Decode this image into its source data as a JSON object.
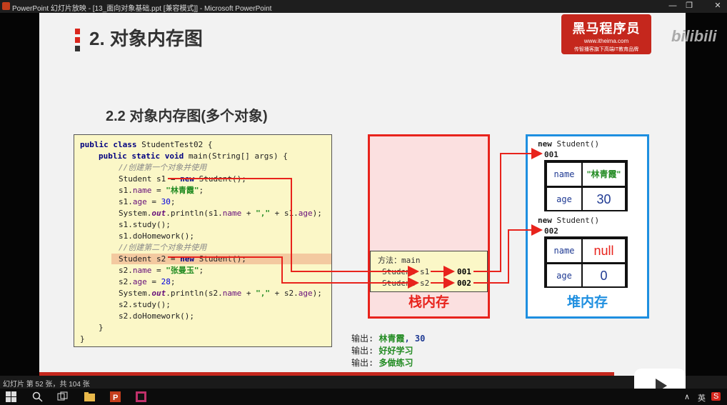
{
  "window": {
    "title": "PowerPoint 幻灯片放映 - [13_面向对象基础.ppt [兼容模式]] - Microsoft PowerPoint",
    "controls": [
      "—",
      "❐",
      "✕"
    ]
  },
  "slide": {
    "title": "2. 对象内存图",
    "subtitle": "2.2 对象内存图(多个对象)",
    "logo": {
      "name": "黑马程序员",
      "url": "www.itheima.com",
      "tagline": "传智播客旗下高端IT教育品牌"
    },
    "code": {
      "l1a": "public class",
      "l1b": " StudentTest02 {",
      "l2a": "public static void",
      "l2b": " main(String[] args) {",
      "c1": "//创建第一个对象并使用",
      "l4a": "Student s1 = ",
      "l4b": "new",
      "l4c": " Student();",
      "l5a": "s1.",
      "l5b": "name",
      "l5c": " = ",
      "l5d": "\"林青霞\"",
      "l5e": ";",
      "l6a": "s1.",
      "l6b": "age",
      "l6c": " = ",
      "l6d": "30",
      "l6e": ";",
      "l7a": "System.",
      "l7b": "out",
      "l7c": ".println(s1.",
      "l7d": "name",
      "l7e": " + ",
      "l7f": "\",\"",
      "l7g": " + s1.",
      "l7h": "age",
      "l7i": ");",
      "l8": "s1.study();",
      "l9": "s1.doHomework();",
      "c2": "//创建第二个对象并使用",
      "l11a": "Student s2 = ",
      "l11b": "new",
      "l11c": " Student();",
      "l12a": "s2.",
      "l12b": "name",
      "l12c": " = ",
      "l12d": "\"张曼玉\"",
      "l12e": ";",
      "l13a": "s2.",
      "l13b": "age",
      "l13c": " = ",
      "l13d": "28",
      "l13e": ";",
      "l14a": "System.",
      "l14b": "out",
      "l14c": ".println(s2.",
      "l14d": "name",
      "l14e": " + ",
      "l14f": "\",\"",
      "l14g": " + s2.",
      "l14h": "age",
      "l14i": ");",
      "l15": "s2.study();",
      "l16": "s2.doHomework();",
      "close1": "}",
      "close2": "}"
    },
    "stack": {
      "label": "栈内存",
      "frame_title": "方法：main",
      "vars": [
        {
          "name": "Student s1",
          "value": "001"
        },
        {
          "name": "Student s2",
          "value": "002"
        }
      ]
    },
    "heap": {
      "label": "堆内存",
      "objects": [
        {
          "header_kw": "new",
          "header_rest": " Student()",
          "addr": "001",
          "name_key": "name",
          "name_val": "\"林青霞\"",
          "age_key": "age",
          "age_val": "30"
        },
        {
          "header_kw": "new",
          "header_rest": " Student()",
          "addr": "002",
          "name_key": "name",
          "name_val": "null",
          "age_key": "age",
          "age_val": "0"
        }
      ]
    },
    "output": [
      {
        "prefix": "输出: ",
        "val": "林青霞",
        "num": ", 30"
      },
      {
        "prefix": "输出: ",
        "val": "好好学习",
        "num": ""
      },
      {
        "prefix": "输出: ",
        "val": "多做练习",
        "num": ""
      }
    ]
  },
  "status": {
    "text": "幻灯片 第 52 张，共 104 张"
  },
  "watermark": "bilibili",
  "tray": {
    "lang": "英",
    "ime": "S"
  },
  "colors": {
    "red": "#e8231c",
    "blue": "#1e8fe0",
    "code_bg": "#fbf7c7",
    "brand": "#c5271d"
  }
}
